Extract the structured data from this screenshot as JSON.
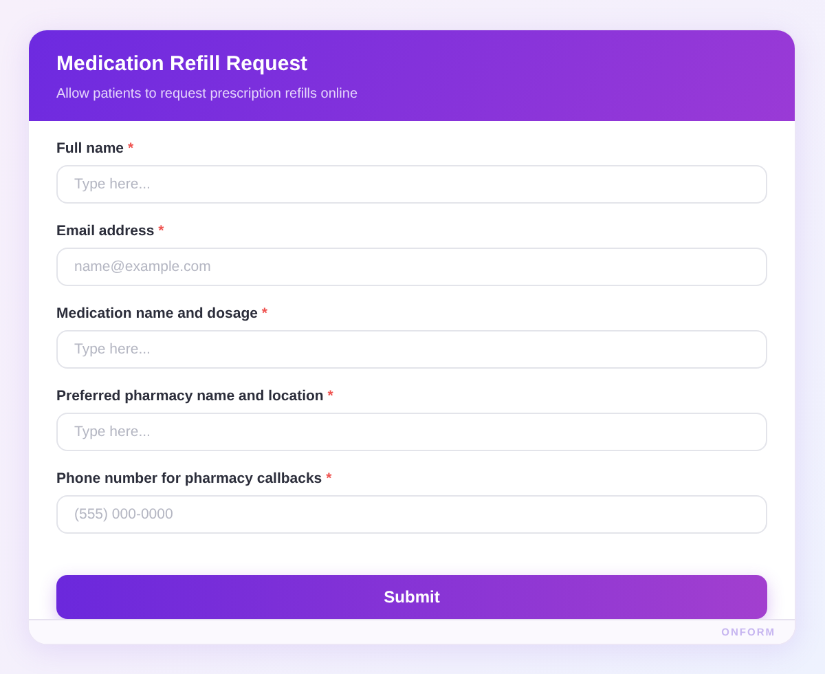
{
  "header": {
    "title": "Medication Refill Request",
    "subtitle": "Allow patients to request prescription refills online"
  },
  "fields": [
    {
      "label": "Full name",
      "mark": "*",
      "placeholder": "Type here..."
    },
    {
      "label": "Email address",
      "mark": "*",
      "placeholder": "name@example.com"
    },
    {
      "label": "Medication name and dosage",
      "mark": "*",
      "placeholder": "Type here..."
    },
    {
      "label": "Preferred pharmacy name and location",
      "mark": "*",
      "placeholder": "Type here..."
    },
    {
      "label": "Phone number for pharmacy callbacks",
      "mark": "*",
      "placeholder": "(555) 000-0000"
    }
  ],
  "submit": "Submit",
  "footer": "ONFORM"
}
